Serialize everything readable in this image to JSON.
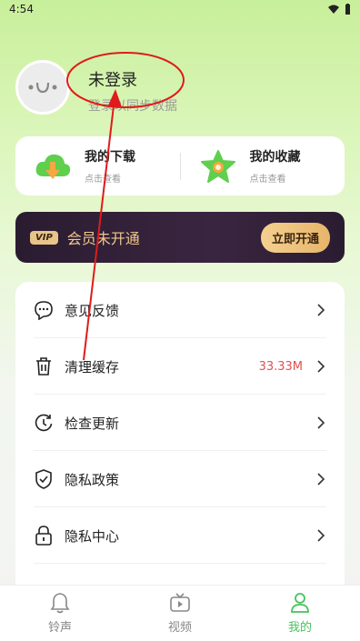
{
  "status_bar": {
    "time": "4:54"
  },
  "profile": {
    "name": "未登录",
    "subtitle": "登录以同步数据"
  },
  "quick_cards": [
    {
      "title": "我的下载",
      "subtitle": "点击查看",
      "icon": "download-cloud-icon"
    },
    {
      "title": "我的收藏",
      "subtitle": "点击查看",
      "icon": "star-icon"
    }
  ],
  "vip": {
    "badge": "VIP",
    "text": "会员未开通",
    "button": "立即开通"
  },
  "menu": [
    {
      "label": "意见反馈",
      "value": "",
      "icon": "feedback-icon"
    },
    {
      "label": "清理缓存",
      "value": "33.33M",
      "icon": "trash-icon"
    },
    {
      "label": "检查更新",
      "value": "",
      "icon": "update-icon"
    },
    {
      "label": "隐私政策",
      "value": "",
      "icon": "shield-icon"
    },
    {
      "label": "隐私中心",
      "value": "",
      "icon": "lock-icon"
    }
  ],
  "tabs": [
    {
      "label": "铃声",
      "icon": "bell-icon",
      "active": false
    },
    {
      "label": "视频",
      "icon": "video-icon",
      "active": false
    },
    {
      "label": "我的",
      "icon": "user-icon",
      "active": true
    }
  ],
  "colors": {
    "accent": "#46c35b",
    "cache_value": "#e05050",
    "vip_bg": "#2a1c30",
    "annotation": "#e01b1b"
  }
}
